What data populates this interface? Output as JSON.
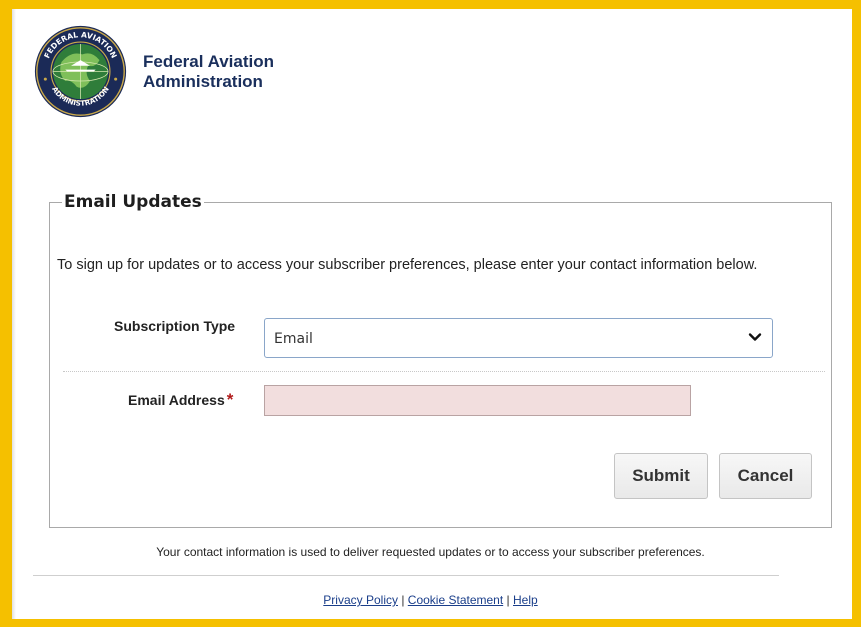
{
  "header": {
    "agency_line1": "Federal Aviation",
    "agency_line2": "Administration",
    "seal_text": "FEDERAL AVIATION ADMINISTRATION"
  },
  "form": {
    "legend": "Email Updates",
    "intro": "To sign up for updates or to access your subscriber preferences, please enter your contact information below.",
    "subscription_type_label": "Subscription Type",
    "subscription_type_value": "Email",
    "email_label": "Email Address",
    "required_marker": "*",
    "email_value": "",
    "submit_label": "Submit",
    "cancel_label": "Cancel"
  },
  "footer": {
    "note": "Your contact information is used to deliver requested updates or to access your subscriber preferences.",
    "links": [
      "Privacy Policy",
      "Cookie Statement",
      "Help"
    ],
    "separator": "|"
  },
  "colors": {
    "frame": "#f5c000",
    "agency_text": "#1a2f5c",
    "input_error_bg": "#f2dede",
    "required": "#b01818",
    "link": "#1a3e8a"
  }
}
